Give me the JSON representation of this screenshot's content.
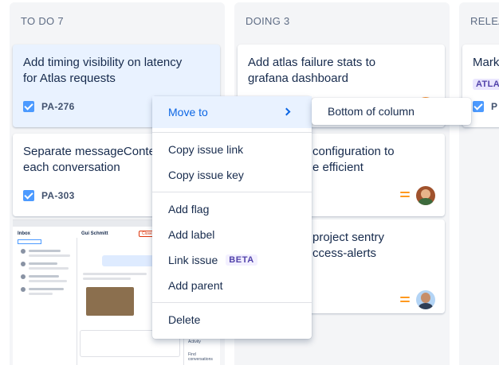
{
  "columns": {
    "todo": {
      "header": "TO DO 7"
    },
    "doing": {
      "header": "DOING 3"
    },
    "release": {
      "header": "RELEA"
    }
  },
  "cards": {
    "todo_1": {
      "title_line1": "Add timing visibility on latency",
      "title_line2": "for Atlas requests",
      "key": "PA-276"
    },
    "todo_2": {
      "title_line1": "Separate messageConten",
      "title_line2": "each conversation",
      "key": "PA-303"
    },
    "doing_1": {
      "title_line1": "Add atlas failure stats to",
      "title_line2": "grafana dashboard"
    },
    "doing_2": {
      "title_line1": "configuration to",
      "title_line2": "e efficient"
    },
    "doing_3": {
      "title_line1": "project sentry",
      "title_line2": "ccess-alerts"
    },
    "release_1": {
      "title": "Mark",
      "label": "ATLA",
      "key": "P"
    }
  },
  "thumbnail": {
    "inbox_title": "Inbox",
    "contact_name": "Gui Schmitt",
    "close_label": "Close",
    "activity_label": "Activity",
    "find_conversations": "Find conversations"
  },
  "context_menu": {
    "move_to": "Move to",
    "copy_link": "Copy issue link",
    "copy_key": "Copy issue key",
    "add_flag": "Add flag",
    "add_label": "Add label",
    "link_issue": "Link issue",
    "beta_badge": "BETA",
    "add_parent": "Add parent",
    "delete": "Delete"
  },
  "submenu": {
    "bottom_of_column": "Bottom of column"
  },
  "colors": {
    "board_bg": "#f4f5f7",
    "selected_card": "#e9f2ff",
    "accent": "#0c66e4",
    "checkbox": "#4c9aff",
    "priority_medium": "#ff991f",
    "label_purple": "#5243aa"
  },
  "icons": [
    "check-square-icon",
    "priority-medium-icon",
    "chevron-right-icon",
    "avatar"
  ]
}
